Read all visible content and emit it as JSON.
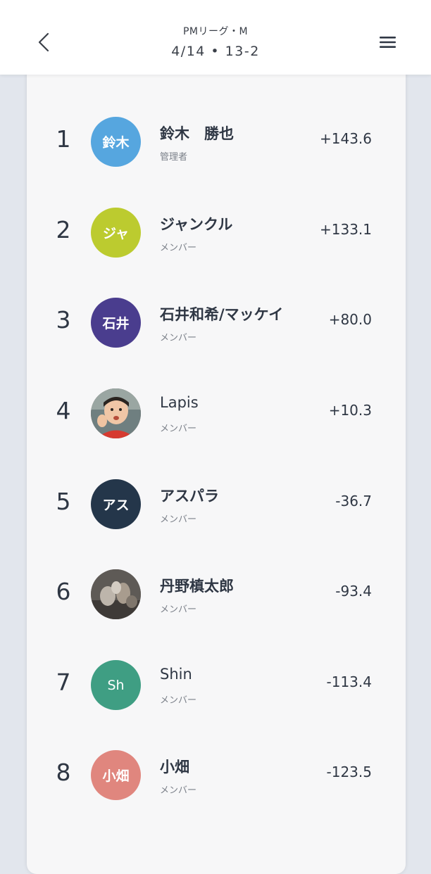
{
  "header": {
    "league": "PMリーグ・M",
    "game": "4/14 • 13-2",
    "back_icon": "chevron-left-icon",
    "menu_icon": "hamburger-menu-icon"
  },
  "ranking": [
    {
      "rank": "1",
      "avatar_text": "鈴木",
      "avatar_color": "#56a6df",
      "name": "鈴木　勝也",
      "role": "管理者",
      "score": "+143.6"
    },
    {
      "rank": "2",
      "avatar_text": "ジャ",
      "avatar_color": "#bccb2f",
      "name": "ジャンクル",
      "role": "メンバー",
      "score": "+133.1"
    },
    {
      "rank": "3",
      "avatar_text": "石井",
      "avatar_color": "#4a3d8e",
      "name": "石井和希/マッケイ",
      "role": "メンバー",
      "score": "+80.0"
    },
    {
      "rank": "4",
      "avatar_text": "",
      "avatar_color": "#8a6a5a",
      "name": "Lapis",
      "role": "メンバー",
      "score": "+10.3"
    },
    {
      "rank": "5",
      "avatar_text": "アス",
      "avatar_color": "#24364a",
      "name": "アスパラ",
      "role": "メンバー",
      "score": "-36.7"
    },
    {
      "rank": "6",
      "avatar_text": "",
      "avatar_color": "#8c847a",
      "name": "丹野槙太郎",
      "role": "メンバー",
      "score": "-93.4"
    },
    {
      "rank": "7",
      "avatar_text": "Sh",
      "avatar_color": "#3f9e83",
      "name": "Shin",
      "role": "メンバー",
      "score": "-113.4"
    },
    {
      "rank": "8",
      "avatar_text": "小畑",
      "avatar_color": "#e0867e",
      "name": "小畑",
      "role": "メンバー",
      "score": "-123.5"
    }
  ]
}
